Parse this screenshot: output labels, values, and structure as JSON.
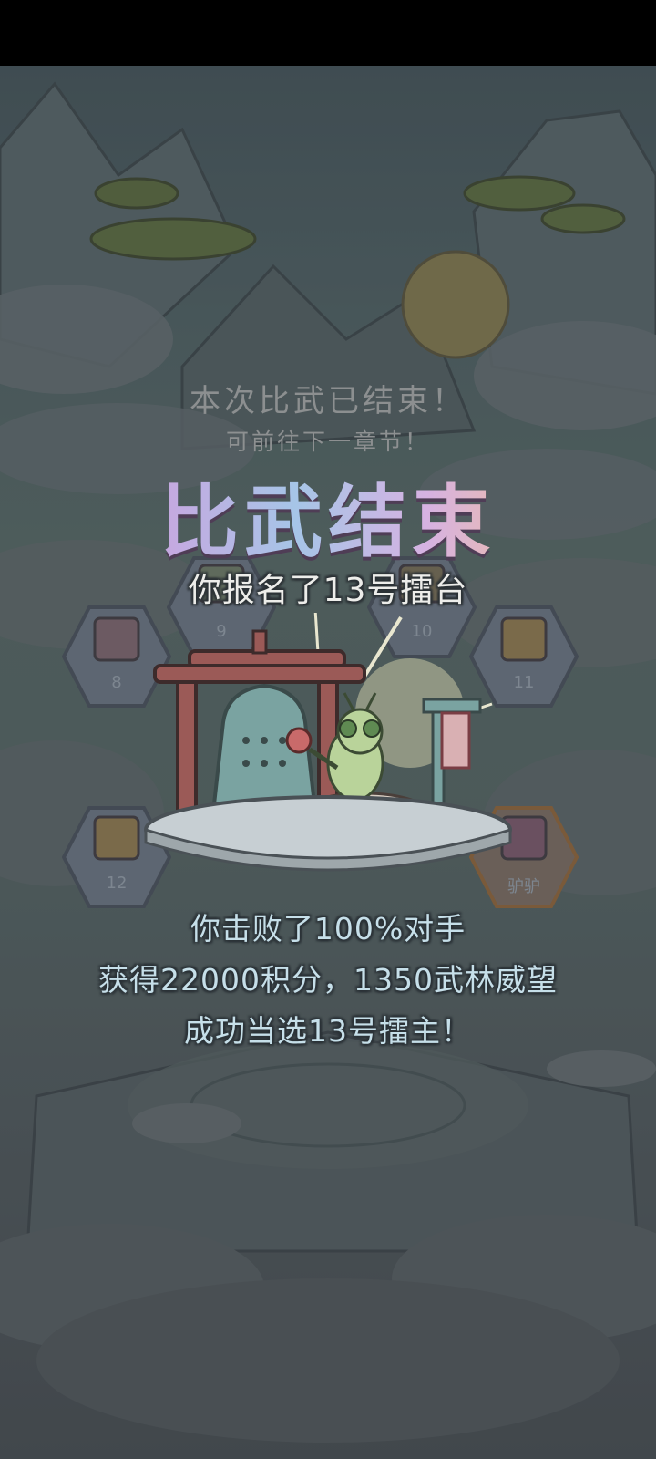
{
  "screen": {
    "subtitle_line1": "本次比武已结束！",
    "subtitle_line2": "可前往下一章节！",
    "title": "比武结束",
    "arena_registered": "你报名了13号擂台",
    "result_defeated": "你击败了100%对手",
    "result_rewards": "获得22000积分，1350武林威望",
    "result_champion": "成功当选13号擂主！"
  },
  "arena_slots": [
    {
      "label": "8"
    },
    {
      "label": "9"
    },
    {
      "label": "10"
    },
    {
      "label": "11"
    },
    {
      "label": "12"
    },
    {
      "label": "驴驴"
    }
  ],
  "colors": {
    "title_gradient_start": "#e3a0b9",
    "title_gradient_end": "#f3d79a",
    "result_text": "#c6dfe9",
    "hex_tile_fill": "#5d6672"
  }
}
